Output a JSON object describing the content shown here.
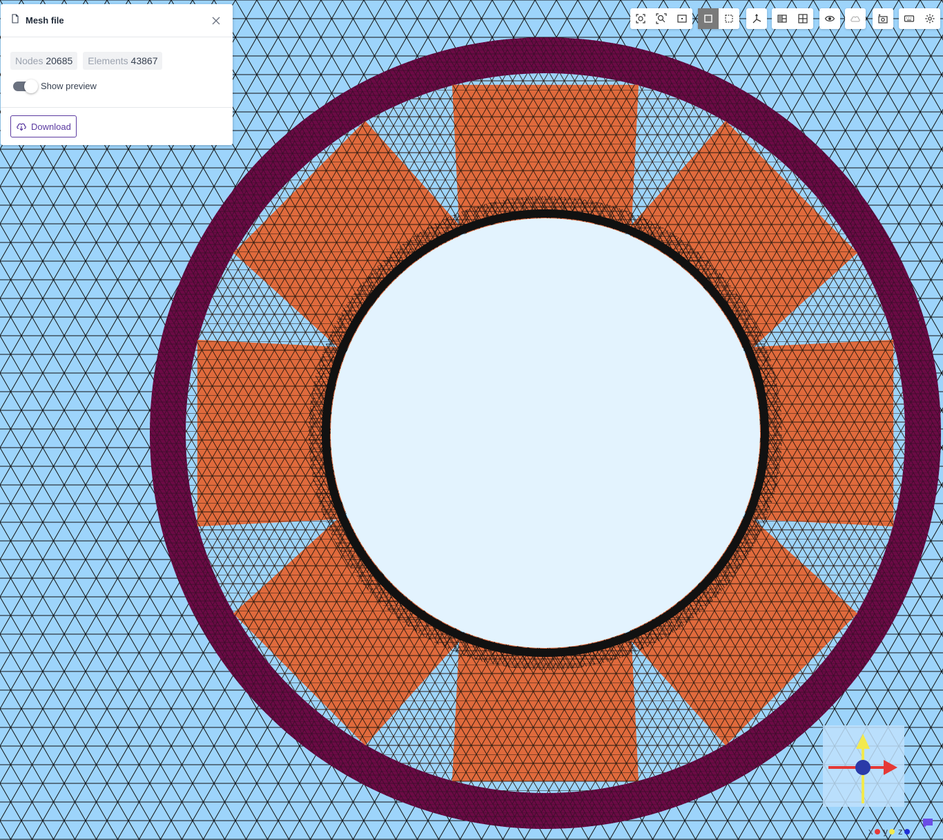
{
  "panel": {
    "title": "Mesh file",
    "nodes_label": "Nodes",
    "nodes_value": "20685",
    "elements_label": "Elements",
    "elements_value": "43867",
    "preview_label": "Show preview",
    "preview_enabled": true,
    "download_label": "Download"
  },
  "toolbar": {
    "groups": [
      [
        "zoom-to-fit-icon",
        "zoom-selection-icon",
        "fit-frame-icon"
      ],
      [
        "solid-view-icon",
        "wireframe-view-icon"
      ],
      [
        "axes-icon"
      ],
      [
        "section-view-icon",
        "grid-view-icon"
      ],
      [
        "visibility-icon"
      ],
      [
        "cloud-visibility-icon"
      ],
      [
        "screenshot-icon"
      ],
      [
        "keyboard-icon",
        "settings-icon"
      ]
    ],
    "active": "solid-view-icon",
    "disabled": "cloud-visibility-icon"
  },
  "axes": {
    "x_label": "x",
    "y_label": "y",
    "z_label": "z",
    "x_color": "#e53935",
    "y_color": "#f2e94e",
    "z_color": "#1e2fd6"
  },
  "colors": {
    "background_region": "#9dd4fb",
    "outer_ring": "#6b0a45",
    "magnets": "#e06a3c",
    "inner_disk": "#e3f3fe",
    "mesh_lines": "#111111",
    "accent": "#5b3aa0"
  }
}
